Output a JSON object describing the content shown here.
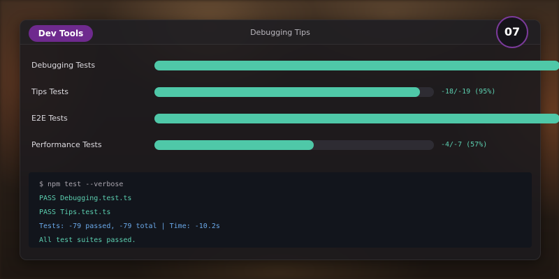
{
  "header": {
    "pill_label": "Dev Tools",
    "title": "Debugging Tips",
    "badge": "07"
  },
  "tests": [
    {
      "label": "Debugging Tests",
      "stat": "",
      "progress_percent": 100
    },
    {
      "label": "Tips Tests",
      "stat": "-18/-19 (95%)",
      "progress_percent": 95
    },
    {
      "label": "E2E Tests",
      "stat": "",
      "progress_percent": 100
    },
    {
      "label": "Performance Tests",
      "stat": "-4/-7 (57%)",
      "progress_percent": 57
    }
  ],
  "terminal": {
    "lines": [
      {
        "text": "$ npm test --verbose",
        "kind": "command"
      },
      {
        "text": "PASS Debugging.test.ts",
        "kind": "pass"
      },
      {
        "text": "PASS Tips.test.ts",
        "kind": "pass"
      },
      {
        "text": "Tests: -79 passed, -79 total | Time: -10.2s",
        "kind": "summary"
      },
      {
        "text": "All test suites passed.",
        "kind": "pass"
      }
    ]
  },
  "colors": {
    "accent_pill": "#6e2a8e",
    "progress_fill": "#4fc8a8",
    "terminal_pass": "#5ccfb0",
    "terminal_summary": "#6aa8e8"
  }
}
